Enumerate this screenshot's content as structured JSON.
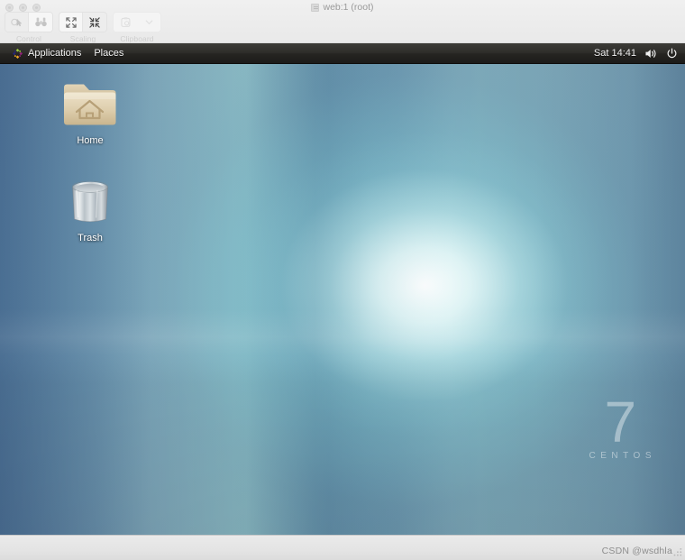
{
  "window": {
    "title": "web:1 (root)",
    "title_icon": "vnc-window-icon"
  },
  "toolbar": {
    "groups": [
      {
        "label": "Control",
        "buttons": [
          {
            "name": "pointer-control-button",
            "icon": "pointer-icon"
          },
          {
            "name": "view-only-button",
            "icon": "binoculars-icon"
          }
        ]
      },
      {
        "label": "Scaling",
        "buttons": [
          {
            "name": "scale-to-fit-button",
            "icon": "expand-arrows-icon"
          },
          {
            "name": "scale-actual-button",
            "icon": "collapse-arrows-icon"
          }
        ]
      },
      {
        "label": "Clipboard",
        "buttons": [
          {
            "name": "clipboard-button",
            "icon": "clipboard-icon"
          },
          {
            "name": "clipboard-menu-button",
            "icon": "chevron-down-icon"
          }
        ]
      }
    ]
  },
  "panel": {
    "logo_icon": "centos-pinwheel-icon",
    "menus": [
      {
        "name": "applications-menu",
        "label": "Applications"
      },
      {
        "name": "places-menu",
        "label": "Places"
      }
    ],
    "clock": "Sat 14:41",
    "status_icons": [
      {
        "name": "volume-icon",
        "glyph": "volume-speaker"
      },
      {
        "name": "power-icon",
        "glyph": "power-symbol"
      }
    ]
  },
  "desktop": {
    "icons": [
      {
        "name": "desktop-icon-home",
        "label": "Home",
        "glyph": "home-folder-icon"
      },
      {
        "name": "desktop-icon-trash",
        "label": "Trash",
        "glyph": "trash-bin-icon"
      }
    ],
    "watermark": {
      "version": "7",
      "distro": "CENTOS"
    }
  },
  "statusbar": {
    "watermark": "CSDN @wsdhla",
    "grip_icon": "resize-grip-icon"
  },
  "colors": {
    "panel_bg": "#2a2926",
    "wallpaper_base": "#5b7c99",
    "wallpaper_glow": "#f0fdfc",
    "folder_tan": "#d8c9a9",
    "chrome_bg": "#ededed"
  }
}
